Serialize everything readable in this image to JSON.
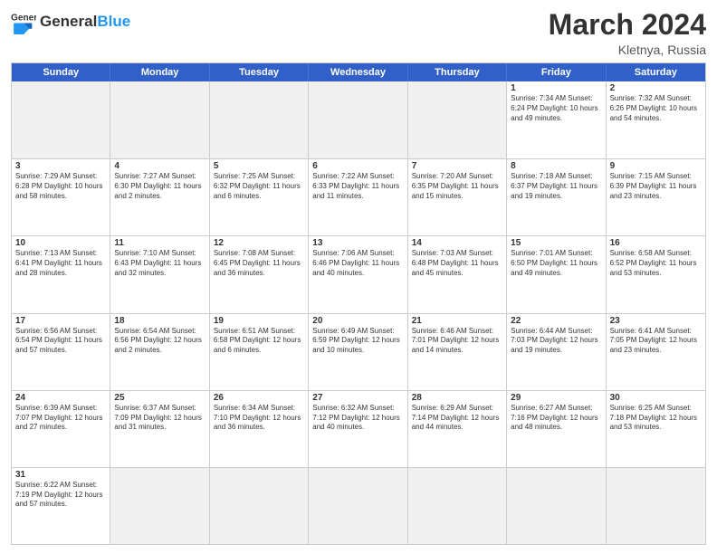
{
  "header": {
    "logo_general": "General",
    "logo_blue": "Blue",
    "month_year": "March 2024",
    "location": "Kletnya, Russia"
  },
  "weekdays": [
    "Sunday",
    "Monday",
    "Tuesday",
    "Wednesday",
    "Thursday",
    "Friday",
    "Saturday"
  ],
  "rows": [
    [
      {
        "day": "",
        "info": "",
        "empty": true
      },
      {
        "day": "",
        "info": "",
        "empty": true
      },
      {
        "day": "",
        "info": "",
        "empty": true
      },
      {
        "day": "",
        "info": "",
        "empty": true
      },
      {
        "day": "",
        "info": "",
        "empty": true
      },
      {
        "day": "1",
        "info": "Sunrise: 7:34 AM\nSunset: 6:24 PM\nDaylight: 10 hours\nand 49 minutes.",
        "empty": false
      },
      {
        "day": "2",
        "info": "Sunrise: 7:32 AM\nSunset: 6:26 PM\nDaylight: 10 hours\nand 54 minutes.",
        "empty": false
      }
    ],
    [
      {
        "day": "3",
        "info": "Sunrise: 7:29 AM\nSunset: 6:28 PM\nDaylight: 10 hours\nand 58 minutes.",
        "empty": false
      },
      {
        "day": "4",
        "info": "Sunrise: 7:27 AM\nSunset: 6:30 PM\nDaylight: 11 hours\nand 2 minutes.",
        "empty": false
      },
      {
        "day": "5",
        "info": "Sunrise: 7:25 AM\nSunset: 6:32 PM\nDaylight: 11 hours\nand 6 minutes.",
        "empty": false
      },
      {
        "day": "6",
        "info": "Sunrise: 7:22 AM\nSunset: 6:33 PM\nDaylight: 11 hours\nand 11 minutes.",
        "empty": false
      },
      {
        "day": "7",
        "info": "Sunrise: 7:20 AM\nSunset: 6:35 PM\nDaylight: 11 hours\nand 15 minutes.",
        "empty": false
      },
      {
        "day": "8",
        "info": "Sunrise: 7:18 AM\nSunset: 6:37 PM\nDaylight: 11 hours\nand 19 minutes.",
        "empty": false
      },
      {
        "day": "9",
        "info": "Sunrise: 7:15 AM\nSunset: 6:39 PM\nDaylight: 11 hours\nand 23 minutes.",
        "empty": false
      }
    ],
    [
      {
        "day": "10",
        "info": "Sunrise: 7:13 AM\nSunset: 6:41 PM\nDaylight: 11 hours\nand 28 minutes.",
        "empty": false
      },
      {
        "day": "11",
        "info": "Sunrise: 7:10 AM\nSunset: 6:43 PM\nDaylight: 11 hours\nand 32 minutes.",
        "empty": false
      },
      {
        "day": "12",
        "info": "Sunrise: 7:08 AM\nSunset: 6:45 PM\nDaylight: 11 hours\nand 36 minutes.",
        "empty": false
      },
      {
        "day": "13",
        "info": "Sunrise: 7:06 AM\nSunset: 6:46 PM\nDaylight: 11 hours\nand 40 minutes.",
        "empty": false
      },
      {
        "day": "14",
        "info": "Sunrise: 7:03 AM\nSunset: 6:48 PM\nDaylight: 11 hours\nand 45 minutes.",
        "empty": false
      },
      {
        "day": "15",
        "info": "Sunrise: 7:01 AM\nSunset: 6:50 PM\nDaylight: 11 hours\nand 49 minutes.",
        "empty": false
      },
      {
        "day": "16",
        "info": "Sunrise: 6:58 AM\nSunset: 6:52 PM\nDaylight: 11 hours\nand 53 minutes.",
        "empty": false
      }
    ],
    [
      {
        "day": "17",
        "info": "Sunrise: 6:56 AM\nSunset: 6:54 PM\nDaylight: 11 hours\nand 57 minutes.",
        "empty": false
      },
      {
        "day": "18",
        "info": "Sunrise: 6:54 AM\nSunset: 6:56 PM\nDaylight: 12 hours\nand 2 minutes.",
        "empty": false
      },
      {
        "day": "19",
        "info": "Sunrise: 6:51 AM\nSunset: 6:58 PM\nDaylight: 12 hours\nand 6 minutes.",
        "empty": false
      },
      {
        "day": "20",
        "info": "Sunrise: 6:49 AM\nSunset: 6:59 PM\nDaylight: 12 hours\nand 10 minutes.",
        "empty": false
      },
      {
        "day": "21",
        "info": "Sunrise: 6:46 AM\nSunset: 7:01 PM\nDaylight: 12 hours\nand 14 minutes.",
        "empty": false
      },
      {
        "day": "22",
        "info": "Sunrise: 6:44 AM\nSunset: 7:03 PM\nDaylight: 12 hours\nand 19 minutes.",
        "empty": false
      },
      {
        "day": "23",
        "info": "Sunrise: 6:41 AM\nSunset: 7:05 PM\nDaylight: 12 hours\nand 23 minutes.",
        "empty": false
      }
    ],
    [
      {
        "day": "24",
        "info": "Sunrise: 6:39 AM\nSunset: 7:07 PM\nDaylight: 12 hours\nand 27 minutes.",
        "empty": false
      },
      {
        "day": "25",
        "info": "Sunrise: 6:37 AM\nSunset: 7:09 PM\nDaylight: 12 hours\nand 31 minutes.",
        "empty": false
      },
      {
        "day": "26",
        "info": "Sunrise: 6:34 AM\nSunset: 7:10 PM\nDaylight: 12 hours\nand 36 minutes.",
        "empty": false
      },
      {
        "day": "27",
        "info": "Sunrise: 6:32 AM\nSunset: 7:12 PM\nDaylight: 12 hours\nand 40 minutes.",
        "empty": false
      },
      {
        "day": "28",
        "info": "Sunrise: 6:29 AM\nSunset: 7:14 PM\nDaylight: 12 hours\nand 44 minutes.",
        "empty": false
      },
      {
        "day": "29",
        "info": "Sunrise: 6:27 AM\nSunset: 7:16 PM\nDaylight: 12 hours\nand 48 minutes.",
        "empty": false
      },
      {
        "day": "30",
        "info": "Sunrise: 6:25 AM\nSunset: 7:18 PM\nDaylight: 12 hours\nand 53 minutes.",
        "empty": false
      }
    ],
    [
      {
        "day": "31",
        "info": "Sunrise: 6:22 AM\nSunset: 7:19 PM\nDaylight: 12 hours\nand 57 minutes.",
        "empty": false
      },
      {
        "day": "",
        "info": "",
        "empty": true
      },
      {
        "day": "",
        "info": "",
        "empty": true
      },
      {
        "day": "",
        "info": "",
        "empty": true
      },
      {
        "day": "",
        "info": "",
        "empty": true
      },
      {
        "day": "",
        "info": "",
        "empty": true
      },
      {
        "day": "",
        "info": "",
        "empty": true
      }
    ]
  ]
}
